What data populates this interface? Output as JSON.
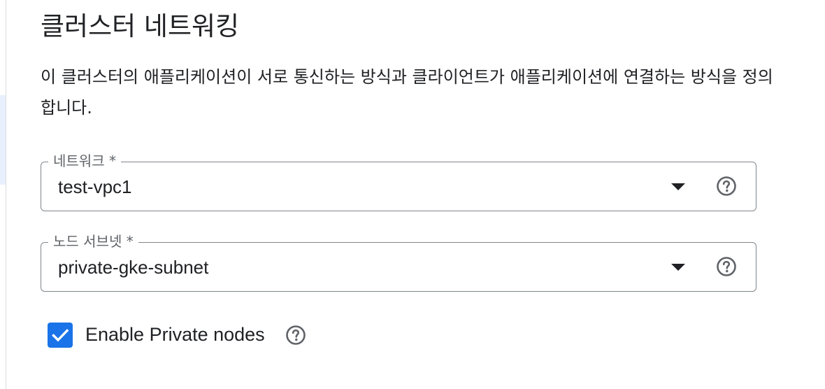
{
  "section": {
    "title": "클러스터 네트워킹",
    "description": "이 클러스터의 애플리케이션이 서로 통신하는 방식과 클라이언트가 애플리케이션에 연결하는 방식을 정의합니다."
  },
  "network_field": {
    "label": "네트워크 *",
    "value": "test-vpc1",
    "icon_dropdown": "dropdown-arrow-icon",
    "icon_help": "help-circle-icon"
  },
  "subnet_field": {
    "label": "노드 서브넷 *",
    "value": "private-gke-subnet",
    "icon_dropdown": "dropdown-arrow-icon",
    "icon_help": "help-circle-icon"
  },
  "private_nodes": {
    "label": "Enable Private nodes",
    "checked": true,
    "icon_help": "help-circle-icon"
  },
  "colors": {
    "accent": "#1a73e8",
    "border": "#80868b",
    "text": "#202124",
    "label": "#5f6368"
  }
}
